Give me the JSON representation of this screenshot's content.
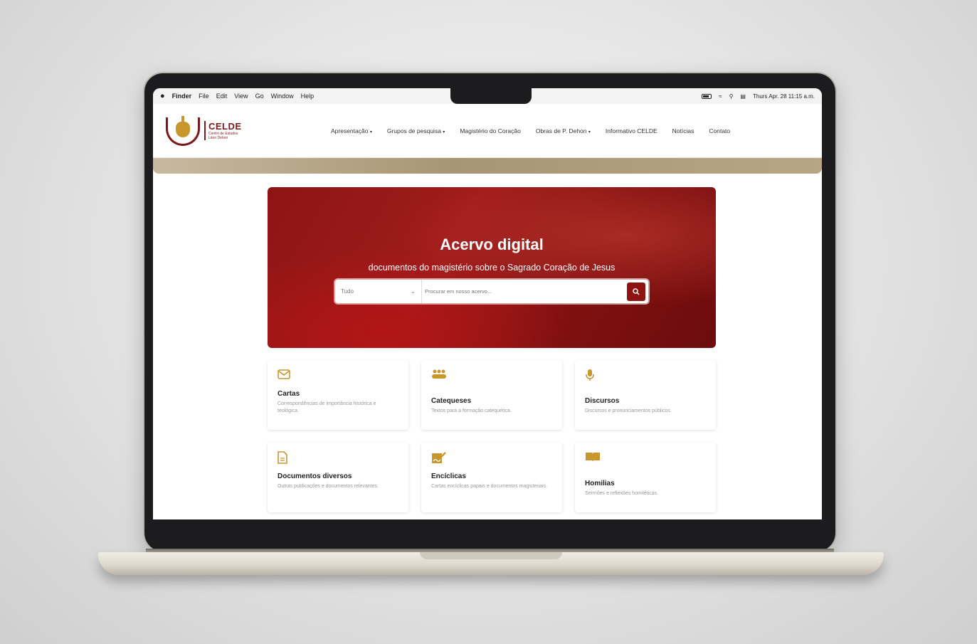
{
  "menubar": {
    "app": "Finder",
    "items": [
      "File",
      "Edit",
      "View",
      "Go",
      "Window",
      "Help"
    ],
    "clock": "Thurs Apr. 28 11:15 a.m."
  },
  "site": {
    "logo_title": "CELDE",
    "logo_sub1": "Centro de Estudos",
    "logo_sub2": "Léon Dehon",
    "nav": [
      {
        "label": "Apresentação",
        "dropdown": true
      },
      {
        "label": "Grupos de pesquisa",
        "dropdown": true
      },
      {
        "label": "Magistério do Coração",
        "dropdown": false
      },
      {
        "label": "Obras de P. Dehon",
        "dropdown": true
      },
      {
        "label": "Informativo CELDE",
        "dropdown": false
      },
      {
        "label": "Notícias",
        "dropdown": false
      },
      {
        "label": "Contato",
        "dropdown": false
      }
    ],
    "caret": "▾"
  },
  "hero": {
    "title": "Acervo digital",
    "subtitle": "documentos do magistério sobre o Sagrado Coração de Jesus",
    "select_value": "Tudo",
    "search_placeholder": "Procurar em nosso acervo...",
    "search_icon": "search-icon"
  },
  "cards": [
    {
      "title": "Cartas",
      "desc": "Correspondências de importância histórica e teológica.",
      "icon": "envelope-icon"
    },
    {
      "title": "Catequeses",
      "desc": "Textos para a formação catequética.",
      "icon": "people-group-icon"
    },
    {
      "title": "Discursos",
      "desc": "Discursos e pronunciamentos públicos.",
      "icon": "microphone-icon"
    },
    {
      "title": "Documentos diversos",
      "desc": "Outras publicações e documentos relevantes.",
      "icon": "document-icon"
    },
    {
      "title": "Encíclicas",
      "desc": "Cartas encíclicas papais e documentos magisteriais.",
      "icon": "signature-icon"
    },
    {
      "title": "Homilias",
      "desc": "Sermões e reflexões homiléticas.",
      "icon": "open-book-icon"
    }
  ],
  "colors": {
    "brand_red": "#8e1414",
    "gold": "#c9962e"
  }
}
